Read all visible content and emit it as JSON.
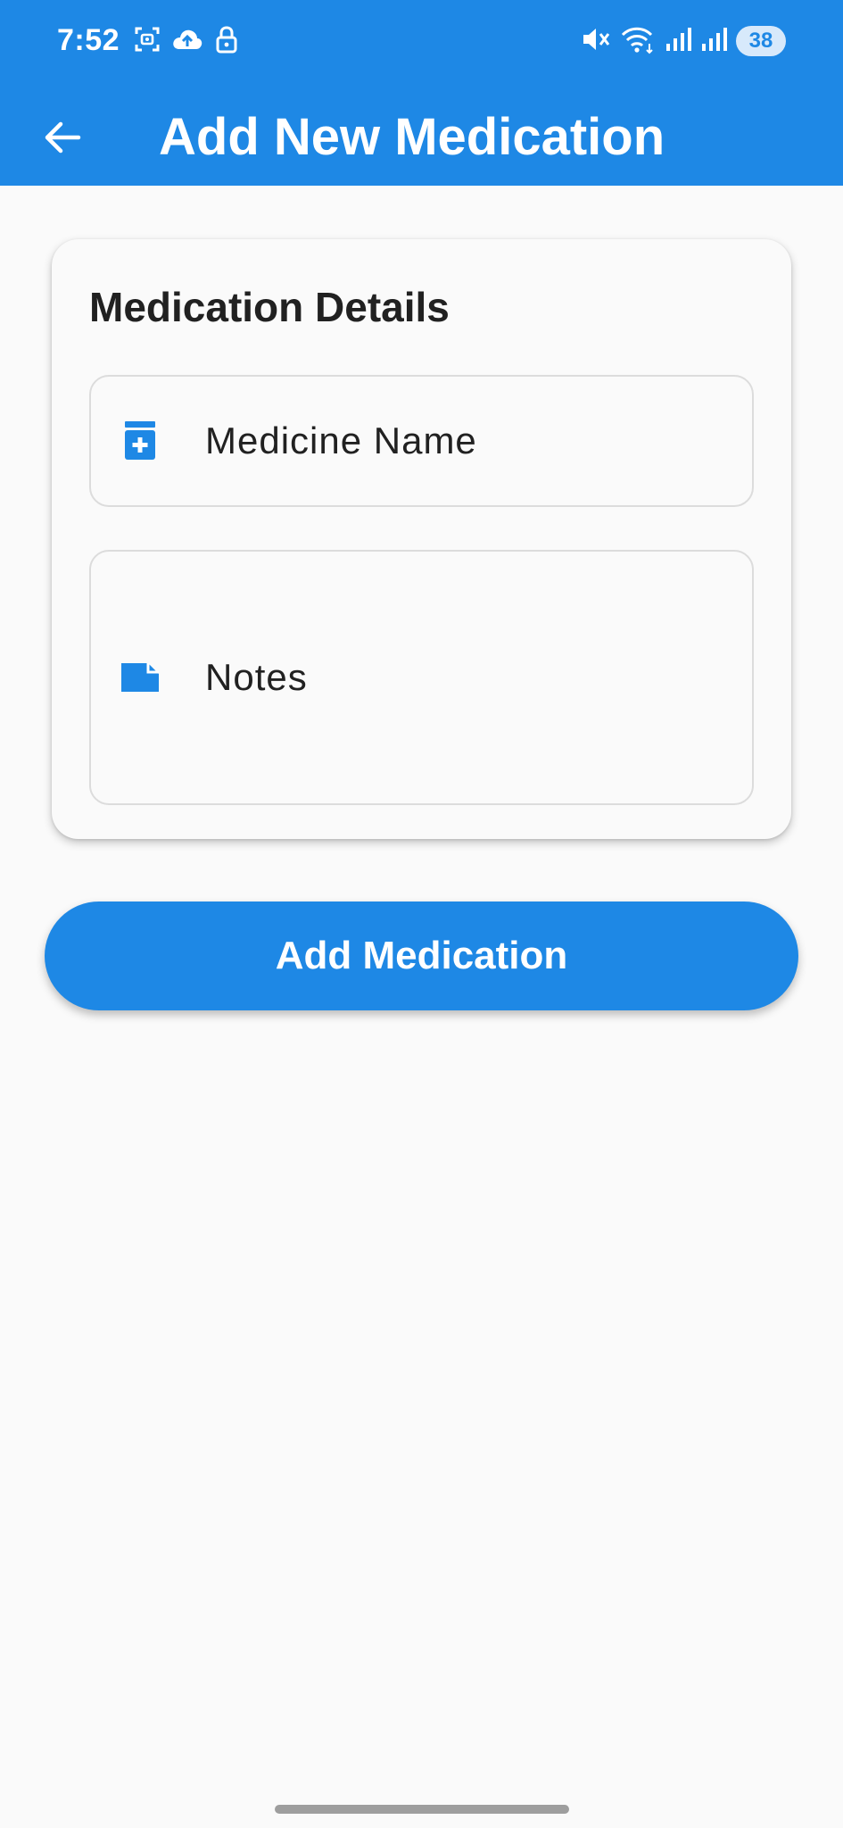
{
  "status_bar": {
    "time": "7:52",
    "battery_level": "38",
    "left_icons": [
      "screenshot-icon",
      "cloud-upload-icon",
      "lock-icon"
    ],
    "right_icons": [
      "mute-icon",
      "wifi-icon",
      "signal-icon",
      "signal-icon"
    ]
  },
  "app_bar": {
    "title": "Add New Medication",
    "back_icon": "arrow-back-icon",
    "background": "#1e88e5"
  },
  "card": {
    "title": "Medication Details",
    "fields": {
      "medicine_name": {
        "placeholder": "Medicine Name",
        "value": "",
        "icon": "medication-icon"
      },
      "notes": {
        "placeholder": "Notes",
        "value": "",
        "icon": "note-icon"
      }
    }
  },
  "actions": {
    "submit_label": "Add Medication"
  },
  "colors": {
    "primary": "#1e88e5",
    "background": "#fafafa",
    "text": "#212121",
    "field_border": "#dcdcdc"
  }
}
